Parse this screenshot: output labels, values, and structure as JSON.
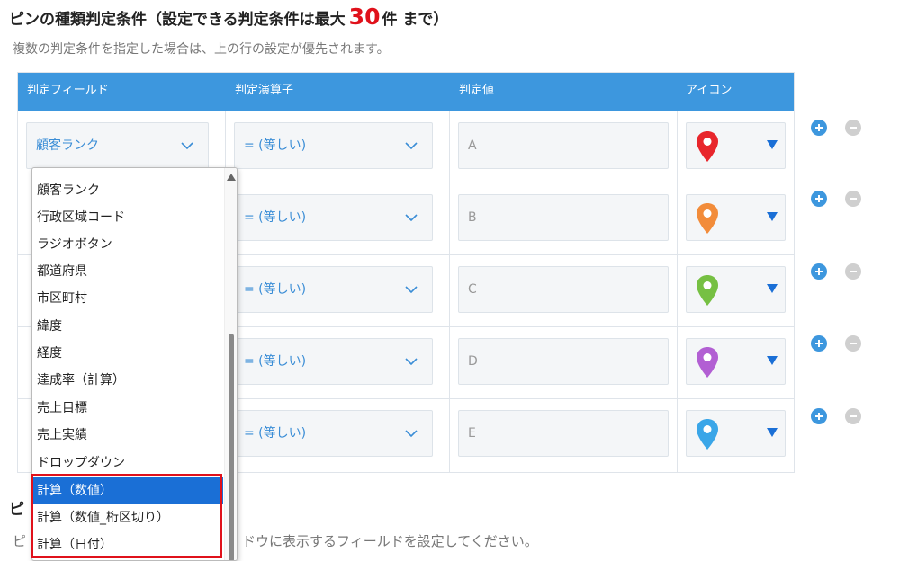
{
  "heading": {
    "text_before": "ピンの種類判定条件（設定できる判定条件は最大",
    "max_count": "30",
    "text_after": "件 まで）"
  },
  "description": "複数の判定条件を指定した場合は、上の行の設定が優先されます。",
  "table": {
    "columns": [
      "判定フィールド",
      "判定演算子",
      "判定値",
      "アイコン"
    ],
    "rows": [
      {
        "field": "顧客ランク",
        "operator": "= (等しい)",
        "value": "A",
        "pin_color": "#e8262c"
      },
      {
        "field": "",
        "operator": "= (等しい)",
        "value": "B",
        "pin_color": "#f28c3a"
      },
      {
        "field": "",
        "operator": "= (等しい)",
        "value": "C",
        "pin_color": "#76c043"
      },
      {
        "field": "",
        "operator": "= (等しい)",
        "value": "D",
        "pin_color": "#b25fd3"
      },
      {
        "field": "",
        "operator": "= (等しい)",
        "value": "E",
        "pin_color": "#3aa6e8"
      }
    ]
  },
  "dropdown": {
    "options": [
      "顧客ランク",
      "行政区域コード",
      "ラジオボタン",
      "都道府県",
      "市区町村",
      "緯度",
      "経度",
      "達成率（計算）",
      "売上目標",
      "売上実績",
      "ドロップダウン",
      "計算（数値）",
      "計算（数値_桁区切り）",
      "計算（日付）"
    ],
    "selected_index": 11,
    "highlighted_from_index": 11
  },
  "bottom": {
    "title_fragment": "ピ",
    "desc_fragment_left": "ピ",
    "desc_fragment_right": "ドウに表示するフィールドを設定してください。"
  },
  "colors": {
    "header_bg": "#3d97de",
    "accent_text": "#3a8dd6",
    "max_red": "#e0111b",
    "selected_option_bg": "#1a6fd6"
  },
  "icons": {
    "chevron": "chevron-down-icon",
    "pin": "map-pin-icon",
    "add": "plus-circle-icon",
    "remove": "minus-circle-icon"
  }
}
